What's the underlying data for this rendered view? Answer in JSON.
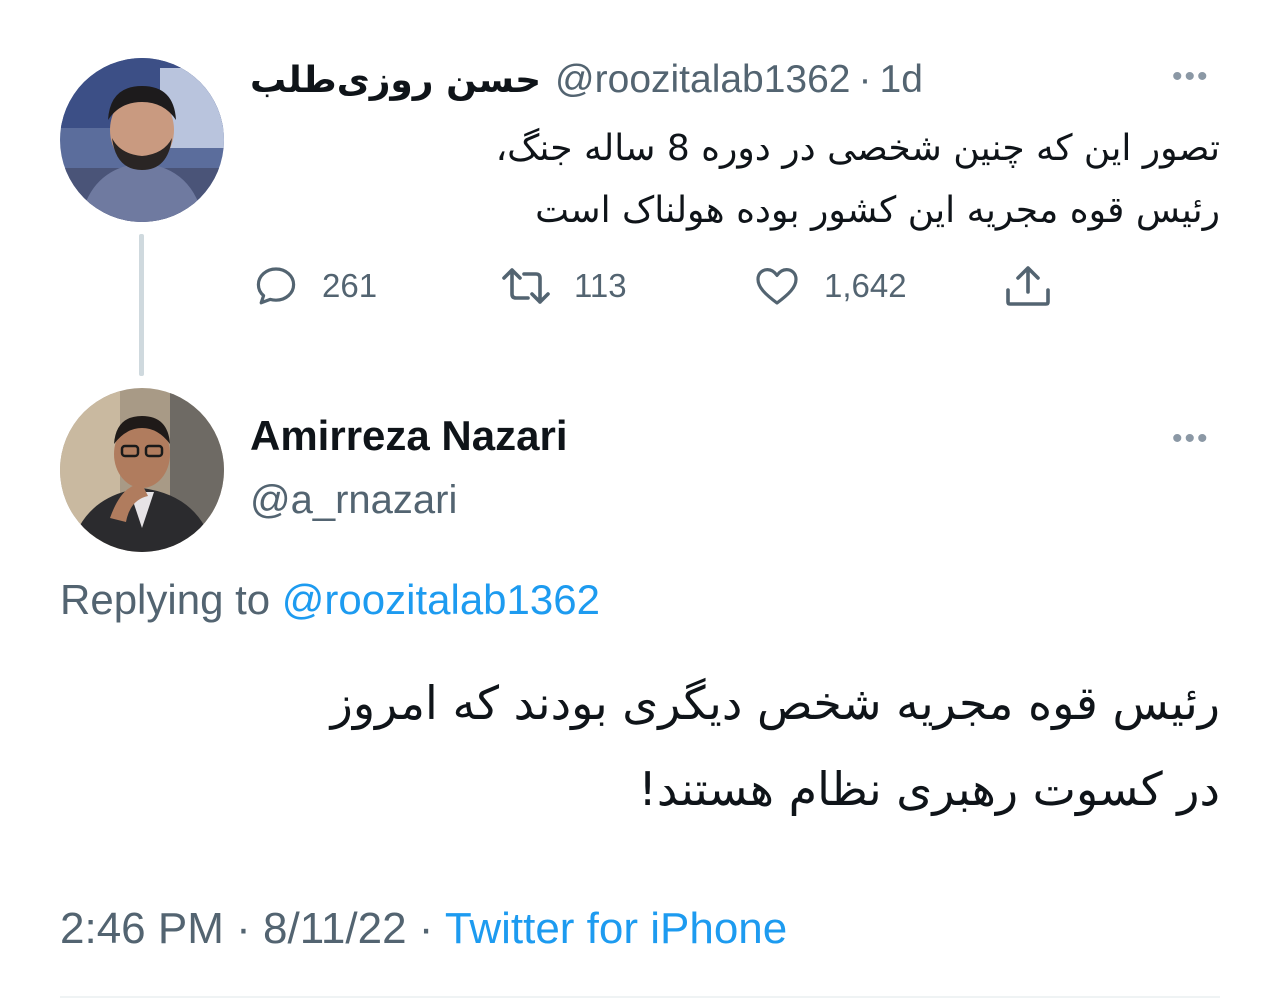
{
  "original_tweet": {
    "display_name": "حسن روزی‌طلب",
    "handle": "@roozitalab1362",
    "separator": "·",
    "time": "1d",
    "more_label": "•••",
    "text_line1": "تصور این که چنین شخصی در دوره 8 ساله جنگ،",
    "text_line2": "رئیس قوه مجریه این کشور بوده هولناک است",
    "stats": {
      "replies": "261",
      "retweets": "113",
      "likes": "1,642"
    },
    "icons": [
      "reply-icon",
      "retweet-icon",
      "like-icon",
      "share-icon"
    ]
  },
  "reply_tweet": {
    "display_name": "Amirreza Nazari",
    "handle": "@a_rnazari",
    "more_label": "•••",
    "replying_prefix": "Replying to",
    "replying_handle": "@roozitalab1362",
    "text_line1": "رئیس قوه مجریه شخص دیگری بودند که امروز",
    "text_line2": "در کسوت رهبری نظام هستند!",
    "time": "2:46 PM",
    "date": "8/11/22",
    "dot": "·",
    "source": "Twitter for iPhone"
  },
  "colors": {
    "text": "#0f1419",
    "secondary": "#536471",
    "accent": "#1d9bf0",
    "line": "#cfd9de"
  }
}
